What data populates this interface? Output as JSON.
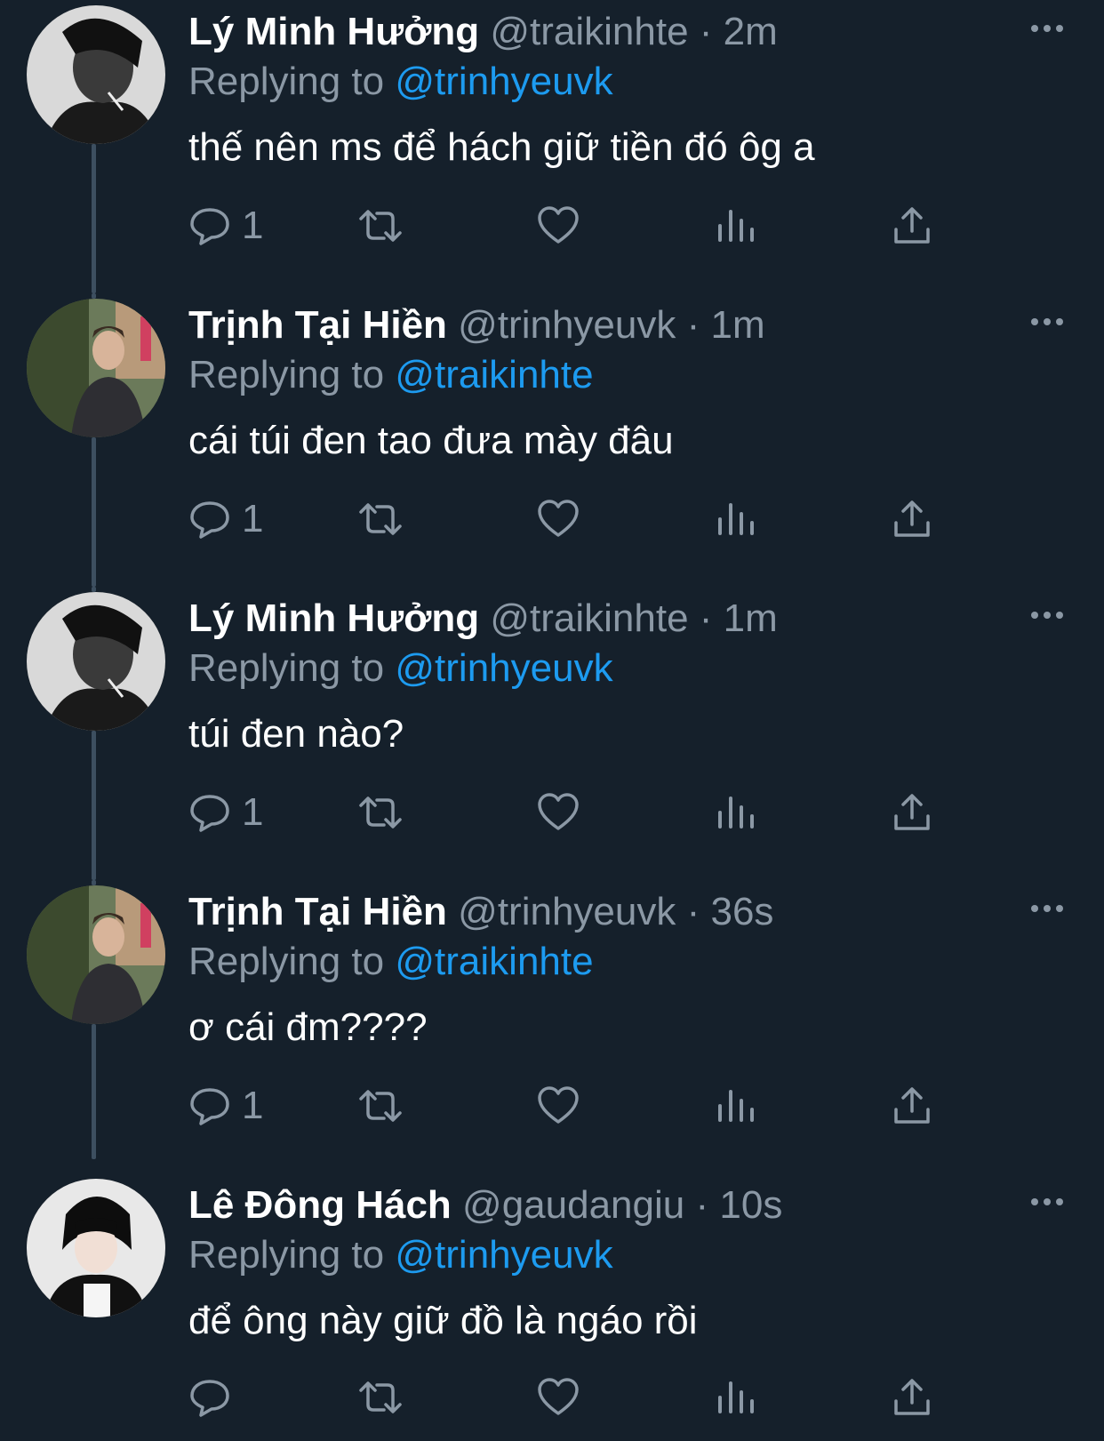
{
  "tweets": [
    {
      "name": "Lý Minh Hưởng",
      "handle": "@traikinhte",
      "sep": "·",
      "time": "2m",
      "replying_prefix": "Replying to",
      "replying_to": "@trinhyeuvk",
      "text": "thế nên ms để hách giữ tiền đó ôg a",
      "reply_count": "1",
      "avatar": "bw-portrait"
    },
    {
      "name": "Trịnh Tại Hiền",
      "handle": "@trinhyeuvk",
      "sep": "·",
      "time": "1m",
      "replying_prefix": "Replying to",
      "replying_to": "@traikinhte",
      "text": "cái túi đen tao đưa mày đâu",
      "reply_count": "1",
      "avatar": "street-photo"
    },
    {
      "name": "Lý Minh Hưởng",
      "handle": "@traikinhte",
      "sep": "·",
      "time": "1m",
      "replying_prefix": "Replying to",
      "replying_to": "@trinhyeuvk",
      "text": "túi đen nào?",
      "reply_count": "1",
      "avatar": "bw-portrait"
    },
    {
      "name": "Trịnh Tại Hiền",
      "handle": "@trinhyeuvk",
      "sep": "·",
      "time": "36s",
      "replying_prefix": "Replying to",
      "replying_to": "@traikinhte",
      "text": "ơ cái đm????",
      "reply_count": "1",
      "avatar": "street-photo"
    },
    {
      "name": "Lê Đông Hách",
      "handle": "@gaudangiu",
      "sep": "·",
      "time": "10s",
      "replying_prefix": "Replying to",
      "replying_to": "@trinhyeuvk",
      "text": "để ông này giữ đồ là ngáo rồi",
      "reply_count": "",
      "avatar": "leather-jacket"
    }
  ],
  "icons": {
    "reply": "reply-icon",
    "retweet": "retweet-icon",
    "like": "heart-icon",
    "views": "analytics-icon",
    "share": "share-icon",
    "more": "more-icon"
  },
  "colors": {
    "background": "#15202b",
    "text": "#ffffff",
    "secondary": "#8b98a5",
    "accent": "#1d9bf0",
    "thread_line": "#3d4f60"
  }
}
